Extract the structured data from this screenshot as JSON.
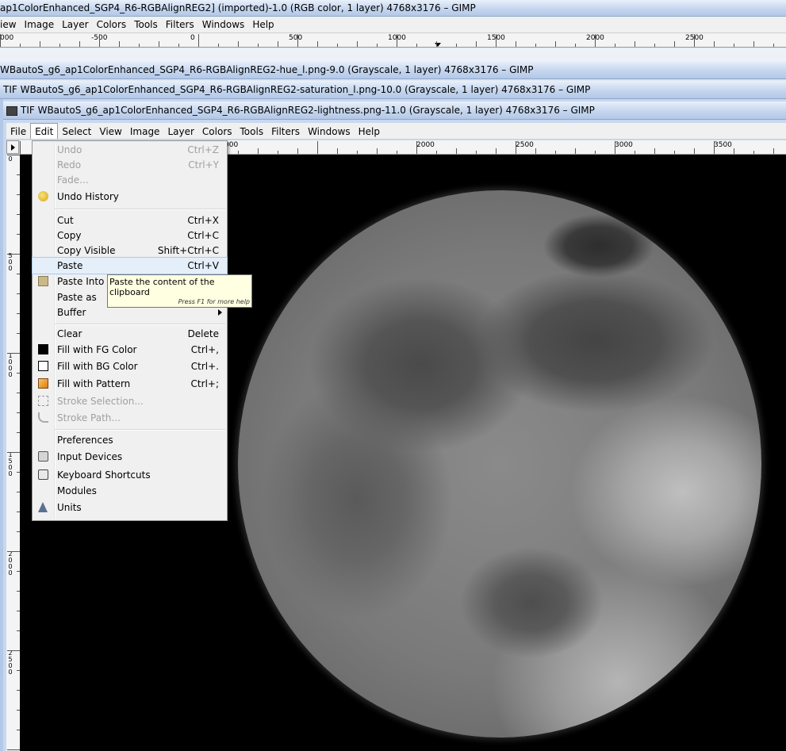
{
  "windows": [
    {
      "title": "ap1ColorEnhanced_SGP4_R6-RGBAlignREG2] (imported)-1.0 (RGB color, 1 layer) 4768x3176 – GIMP"
    },
    {
      "title": "WBautoS_g6_ap1ColorEnhanced_SGP4_R6-RGBAlignREG2-hue_l.png-9.0 (Grayscale, 1 layer) 4768x3176 – GIMP"
    },
    {
      "title": "TIF WBautoS_g6_ap1ColorEnhanced_SGP4_R6-RGBAlignREG2-saturation_l.png-10.0 (Grayscale, 1 layer) 4768x3176 – GIMP"
    },
    {
      "title": "TIF WBautoS_g6_ap1ColorEnhanced_SGP4_R6-RGBAlignREG2-lightness.png-11.0 (Grayscale, 1 layer) 4768x3176 – GIMP"
    }
  ],
  "back_menubar": [
    "iew",
    "Image",
    "Layer",
    "Colors",
    "Tools",
    "Filters",
    "Windows",
    "Help"
  ],
  "back_ruler": [
    "000",
    "-500",
    "0",
    "500",
    "1000",
    "1500",
    "2000",
    "2500"
  ],
  "front_menubar": [
    "File",
    "Edit",
    "Select",
    "View",
    "Image",
    "Layer",
    "Colors",
    "Tools",
    "Filters",
    "Windows",
    "Help"
  ],
  "front_ruler": [
    "000",
    "2000",
    "2500",
    "3000",
    "3500"
  ],
  "vruler": [
    "0",
    "500",
    "1000",
    "1500",
    "2000",
    "2500"
  ],
  "edit_menu": {
    "undo": {
      "label": "Undo",
      "accel": "Ctrl+Z"
    },
    "redo": {
      "label": "Redo",
      "accel": "Ctrl+Y"
    },
    "fade": {
      "label": "Fade..."
    },
    "undo_history": {
      "label": "Undo History"
    },
    "cut": {
      "label": "Cut",
      "accel": "Ctrl+X"
    },
    "copy": {
      "label": "Copy",
      "accel": "Ctrl+C"
    },
    "copy_visible": {
      "label": "Copy Visible",
      "accel": "Shift+Ctrl+C"
    },
    "paste": {
      "label": "Paste",
      "accel": "Ctrl+V"
    },
    "paste_into": {
      "label": "Paste Into"
    },
    "paste_as": {
      "label": "Paste as"
    },
    "buffer": {
      "label": "Buffer"
    },
    "clear": {
      "label": "Clear",
      "accel": "Delete"
    },
    "fill_fg": {
      "label": "Fill with FG Color",
      "accel": "Ctrl+,"
    },
    "fill_bg": {
      "label": "Fill with BG Color",
      "accel": "Ctrl+."
    },
    "fill_pattern": {
      "label": "Fill with Pattern",
      "accel": "Ctrl+;"
    },
    "stroke_selection": {
      "label": "Stroke Selection..."
    },
    "stroke_path": {
      "label": "Stroke Path..."
    },
    "preferences": {
      "label": "Preferences"
    },
    "input_devices": {
      "label": "Input Devices"
    },
    "keyboard_shortcuts": {
      "label": "Keyboard Shortcuts"
    },
    "modules": {
      "label": "Modules"
    },
    "units": {
      "label": "Units"
    }
  },
  "tooltip": {
    "text": "Paste the content of the clipboard",
    "hint": "Press F1 for more help"
  },
  "colors": {
    "fg": "#000000",
    "bg": "#ffffff",
    "highlight": "#e5effa",
    "pattern": "#f0a030"
  }
}
